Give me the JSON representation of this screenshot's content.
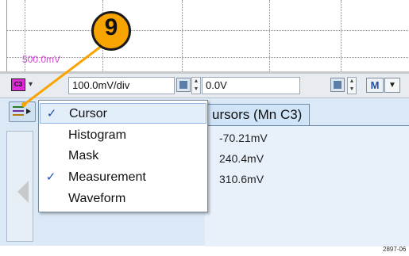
{
  "plot": {
    "scale_label": "500.0mV"
  },
  "callout": {
    "number": "9"
  },
  "toolbar": {
    "channel": "C3",
    "channel_color": "#e02ad8",
    "scale_value": "100.0mV/div",
    "offset_value": "0.0V",
    "math_button": "M"
  },
  "menu": {
    "items": [
      {
        "label": "Cursor",
        "checked": true,
        "check": "✓"
      },
      {
        "label": "Histogram",
        "checked": false,
        "check": ""
      },
      {
        "label": "Mask",
        "checked": false,
        "check": ""
      },
      {
        "label": "Measurement",
        "checked": true,
        "check": "✓"
      },
      {
        "label": "Waveform",
        "checked": false,
        "check": ""
      }
    ]
  },
  "cursor_panel": {
    "title": "ursors (Mn C3)",
    "values": [
      "-70.21mV",
      "240.4mV",
      "310.6mV"
    ]
  },
  "figure_code": "2897-06",
  "colors": {
    "callout": "#f7a400",
    "panel_bg": "#dbe9f6",
    "accent": "#1d4fb3"
  }
}
